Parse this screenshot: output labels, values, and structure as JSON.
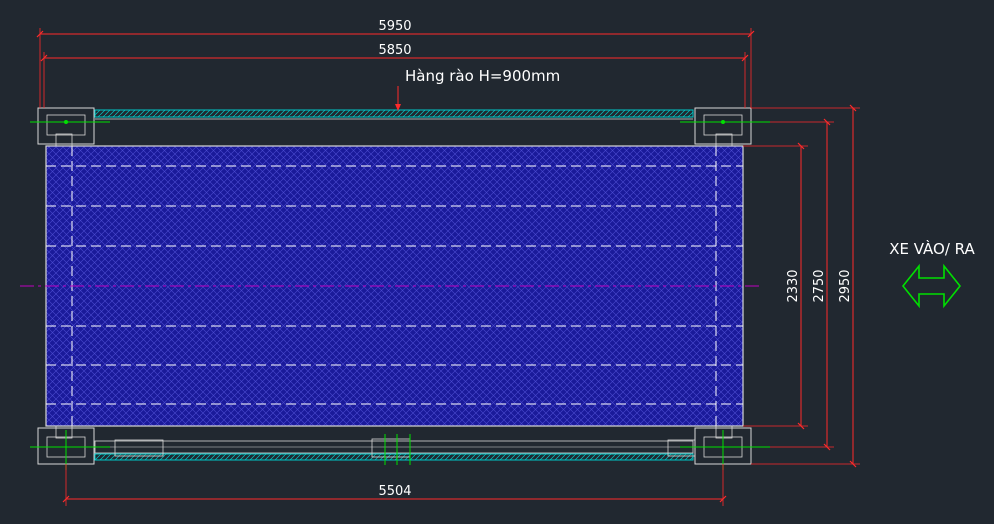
{
  "dimensions": {
    "overall_width": "5950",
    "inner_width": "5850",
    "bottom_width": "5504",
    "height_inner": "2330",
    "height_mid": "2750",
    "height_outer": "2950"
  },
  "labels": {
    "fence_note": "Hàng rào H=900mm",
    "vehicle_direction": "XE VÀO/ RA"
  },
  "icons": {
    "direction_arrow": "double-arrow-icon"
  },
  "colors": {
    "background": "#212830",
    "platform_fill": "#1a1a9a",
    "dimension_line": "#ff2a2a",
    "outline": "#d8d8d8",
    "center_line": "#c000c0",
    "fence": "#00c8c8",
    "arrow": "#00e000"
  }
}
